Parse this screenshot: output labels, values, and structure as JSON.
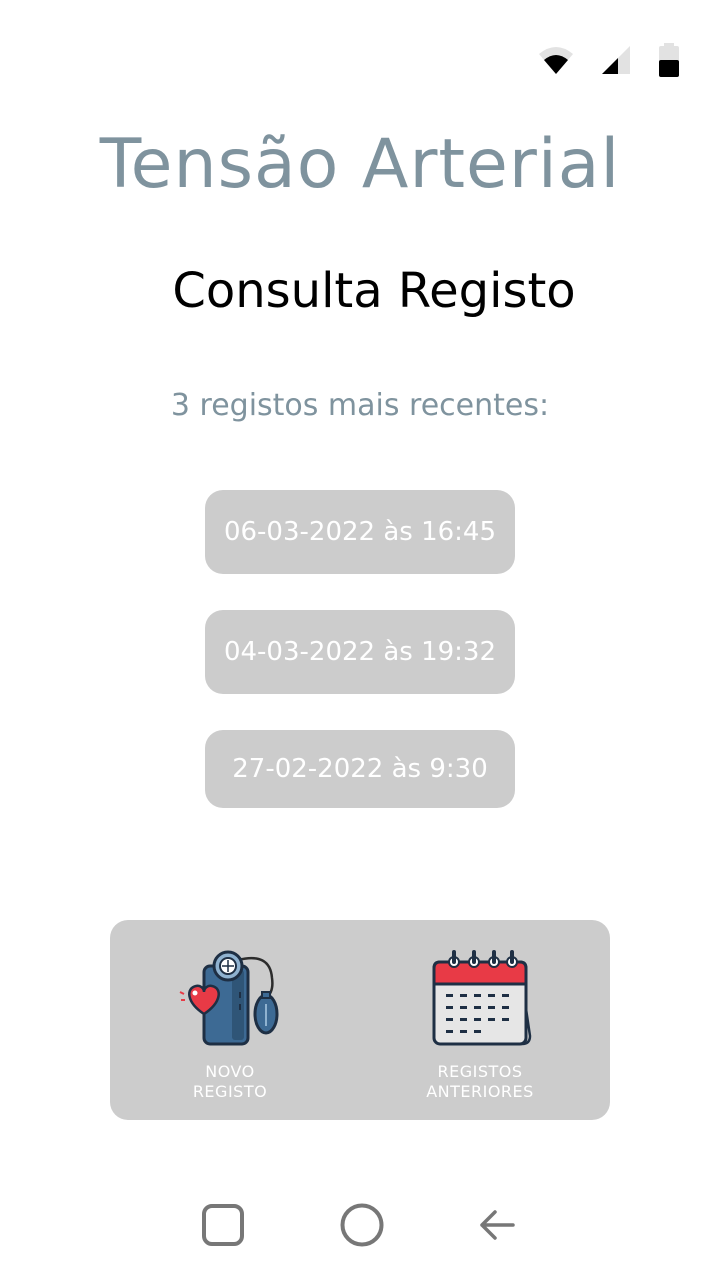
{
  "status_bar": {
    "icons": [
      "wifi-icon",
      "signal-icon",
      "battery-icon"
    ]
  },
  "app": {
    "title": "Tensão Arterial"
  },
  "screen": {
    "title": "Consulta Registo",
    "records_heading": "3 registos mais recentes:"
  },
  "records": [
    {
      "label": "06-03-2022 às 16:45"
    },
    {
      "label": "04-03-2022 às 19:32"
    },
    {
      "label": "27-02-2022 às 9:30"
    }
  ],
  "actions": {
    "new_record": {
      "line1": "NOVO",
      "line2": "REGISTO",
      "icon": "blood-pressure-monitor-icon"
    },
    "previous_records": {
      "line1": "REGISTOS",
      "line2": "ANTERIORES",
      "icon": "calendar-icon"
    }
  },
  "nav_bar": {
    "icons": [
      "recents-icon",
      "home-icon",
      "back-icon"
    ]
  },
  "colors": {
    "accent_grey_blue": "#7f939e",
    "button_grey": "#cccccc",
    "text_on_button": "#ffffff"
  }
}
